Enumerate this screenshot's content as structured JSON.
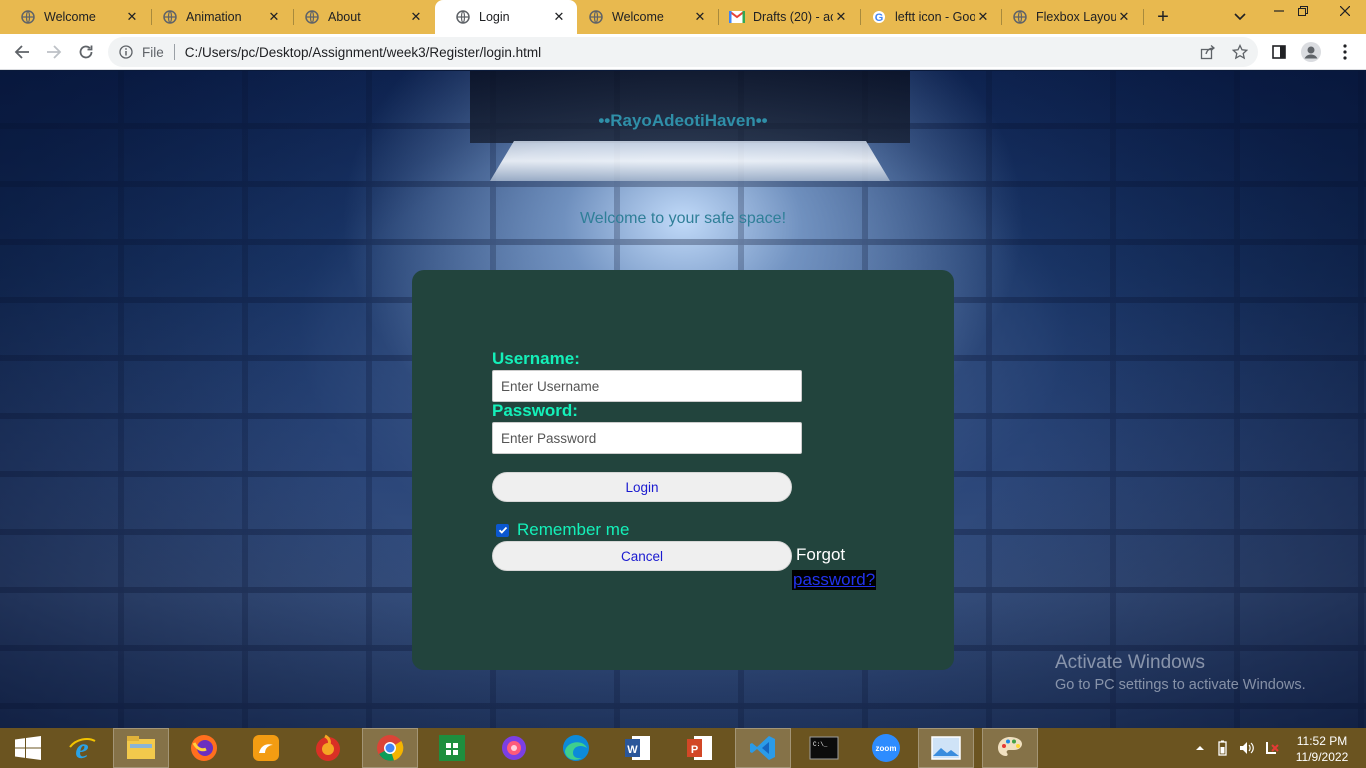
{
  "browser": {
    "tabs": [
      {
        "title": "Welcome",
        "icon": "globe-icon",
        "active": false
      },
      {
        "title": "Animation",
        "icon": "globe-icon",
        "active": false
      },
      {
        "title": "About",
        "icon": "globe-icon",
        "active": false
      },
      {
        "title": "Login",
        "icon": "globe-icon",
        "active": true
      },
      {
        "title": "Welcome",
        "icon": "globe-icon",
        "active": false
      },
      {
        "title": "Drafts (20) - ac",
        "icon": "gmail-icon",
        "active": false
      },
      {
        "title": "leftt icon - Goo",
        "icon": "google-icon",
        "active": false
      },
      {
        "title": "Flexbox Layout",
        "icon": "globe-icon",
        "active": false
      }
    ],
    "address": {
      "scheme_label": "File",
      "url": "C:/Users/pc/Desktop/Assignment/week3/Register/login.html"
    }
  },
  "page": {
    "site_title": "••RayoAdeotiHaven••",
    "tagline": "Welcome to your safe space!",
    "form": {
      "username_label": "Username:",
      "username_placeholder": "Enter Username",
      "password_label": "Password:",
      "password_placeholder": "Enter Password",
      "login_label": "Login",
      "remember_label": "Remember me",
      "remember_checked": true,
      "cancel_label": "Cancel",
      "forgot_text": "Forgot",
      "forgot_link": "password?"
    }
  },
  "watermark": {
    "line1": "Activate Windows",
    "line2": "Go to PC settings to activate Windows."
  },
  "taskbar": {
    "apps": [
      "start",
      "internet-explorer",
      "file-explorer",
      "firefox",
      "uc-browser",
      "firefox-alt",
      "chrome",
      "store",
      "arc",
      "edge",
      "word",
      "powerpoint",
      "vscode",
      "terminal",
      "zoom",
      "photos",
      "paint"
    ],
    "zoom_label": "zoom",
    "time": "11:52 PM",
    "date": "11/9/2022"
  },
  "colors": {
    "tabstrip": "#e8b94f",
    "card": "#22443d",
    "label_accent": "#14f0b9",
    "taskbar": "#6b5420"
  }
}
